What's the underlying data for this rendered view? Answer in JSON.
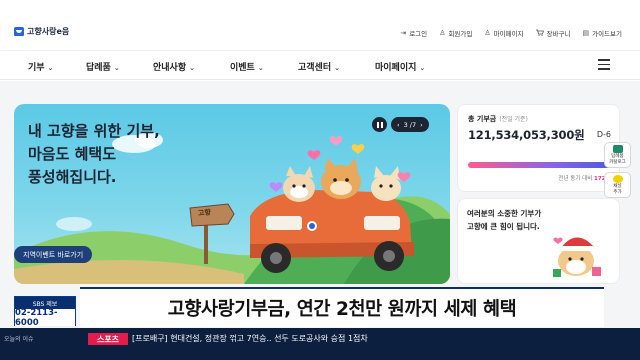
{
  "header": {
    "logo_text": "고향사랑e음",
    "util_links": [
      {
        "label": "로그인",
        "icon": "login-icon",
        "glyph": "⇥"
      },
      {
        "label": "회원가입",
        "icon": "user-plus-icon",
        "glyph": "♙"
      },
      {
        "label": "마이페이지",
        "icon": "user-icon",
        "glyph": "♙"
      },
      {
        "label": "장바구니",
        "icon": "cart-icon",
        "glyph": "🛒"
      },
      {
        "label": "가이드보기",
        "icon": "guide-icon",
        "glyph": "▤"
      }
    ]
  },
  "nav": {
    "items": [
      {
        "label": "기부",
        "has_dropdown": true
      },
      {
        "label": "답례품",
        "has_dropdown": true
      },
      {
        "label": "안내사항",
        "has_dropdown": true
      },
      {
        "label": "이벤트",
        "has_dropdown": true
      },
      {
        "label": "고객센터",
        "has_dropdown": true
      },
      {
        "label": "마이페이지",
        "has_dropdown": true
      }
    ],
    "menu_icon": "hamburger-icon"
  },
  "hero": {
    "title": "내 고향을 위한 기부,\n마음도 혜택도\n풍성해집니다.",
    "cta_label": "지역이벤트 바로가기",
    "signpost_text": "고향",
    "pager_text": "3 /7",
    "pause_icon": "pause-icon",
    "prev_icon": "‹",
    "next_icon": "›"
  },
  "stats": {
    "label": "총 기부금",
    "sublabel": "(전일 기준)",
    "amount": "121,534,053,300원",
    "dday": "D-6",
    "progress_ratio": 1.0,
    "note_prefix": "전년 동기 대비",
    "note_value": "172%"
  },
  "message": {
    "text": "여러분의 소중한 기부가\n고향에 큰 힘이 됩니다."
  },
  "side_buttons": [
    {
      "label": "답례품\n카탈로그",
      "icon": "catalog-icon",
      "color": "#1f8a6b"
    },
    {
      "label": "채널\n추가",
      "icon": "chat-icon",
      "color": "#f2d100"
    }
  ],
  "broadcast": {
    "sbs_label": "SBS 제보",
    "phone": "02-2113-6000",
    "caption": "고향사랑기부금, 연간 2천만 원까지 세제 혜택",
    "ticker_left": "오늘의 이슈",
    "ticker_tag": "스포츠",
    "ticker_text": "[프로배구] 현대건설, 정관장 꺾고 7연승.. 선두 도로공사와 승점 1점차"
  },
  "colors": {
    "brand_blue": "#2b63d9",
    "hero_sky": "#5cc9e6",
    "accent_pink": "#e23c7a",
    "broadcast_navy": "#0d1f3f",
    "ticker_red": "#e31c4b"
  }
}
